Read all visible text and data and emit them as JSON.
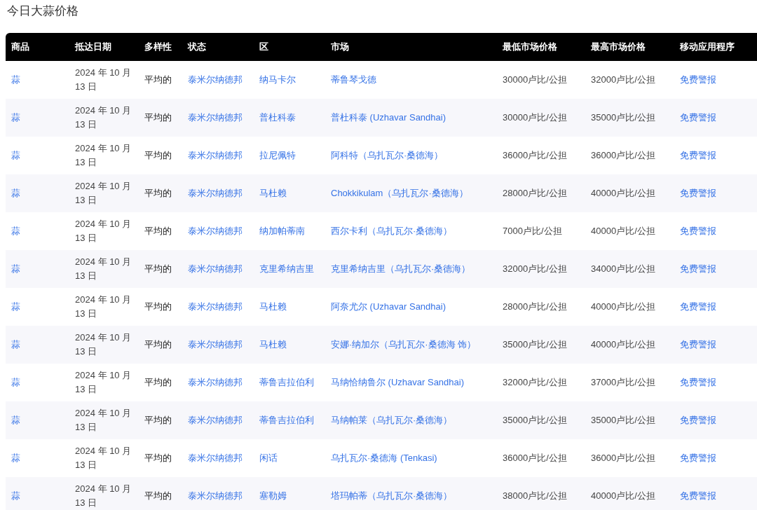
{
  "title": "今日大蒜价格",
  "table": {
    "columns": [
      "商品",
      "抵达日期",
      "多样性",
      "状态",
      "区",
      "市场",
      "最低市场价格",
      "最高市场价格",
      "移动应用程序"
    ],
    "rows": [
      {
        "commodity": "蒜",
        "date": "2024 年 10 月 13 日",
        "variety": "平均的",
        "state": "泰米尔纳德邦",
        "district": "纳马卡尔",
        "market": "蒂鲁琴戈德",
        "min_price": "30000卢比/公担",
        "max_price": "32000卢比/公担",
        "app": "免费警报"
      },
      {
        "commodity": "蒜",
        "date": "2024 年 10 月 13 日",
        "variety": "平均的",
        "state": "泰米尔纳德邦",
        "district": "普杜科泰",
        "market": "普杜科泰 (Uzhavar Sandhai)",
        "min_price": "30000卢比/公担",
        "max_price": "35000卢比/公担",
        "app": "免费警报"
      },
      {
        "commodity": "蒜",
        "date": "2024 年 10 月 13 日",
        "variety": "平均的",
        "state": "泰米尔纳德邦",
        "district": "拉尼佩特",
        "market": "阿科特（乌扎瓦尔·桑德海）",
        "min_price": "36000卢比/公担",
        "max_price": "36000卢比/公担",
        "app": "免费警报"
      },
      {
        "commodity": "蒜",
        "date": "2024 年 10 月 13 日",
        "variety": "平均的",
        "state": "泰米尔纳德邦",
        "district": "马杜赖",
        "market": "Chokkikulam（乌扎瓦尔·桑德海）",
        "min_price": "28000卢比/公担",
        "max_price": "40000卢比/公担",
        "app": "免费警报"
      },
      {
        "commodity": "蒜",
        "date": "2024 年 10 月 13 日",
        "variety": "平均的",
        "state": "泰米尔纳德邦",
        "district": "纳加帕蒂南",
        "market": "西尔卡利（乌扎瓦尔·桑德海）",
        "min_price": "7000卢比/公担",
        "max_price": "40000卢比/公担",
        "app": "免费警报"
      },
      {
        "commodity": "蒜",
        "date": "2024 年 10 月 13 日",
        "variety": "平均的",
        "state": "泰米尔纳德邦",
        "district": "克里希纳吉里",
        "market": "克里希纳吉里（乌扎瓦尔·桑德海）",
        "min_price": "32000卢比/公担",
        "max_price": "34000卢比/公担",
        "app": "免费警报"
      },
      {
        "commodity": "蒜",
        "date": "2024 年 10 月 13 日",
        "variety": "平均的",
        "state": "泰米尔纳德邦",
        "district": "马杜赖",
        "market": "阿奈尤尔 (Uzhavar Sandhai)",
        "min_price": "28000卢比/公担",
        "max_price": "40000卢比/公担",
        "app": "免费警报"
      },
      {
        "commodity": "蒜",
        "date": "2024 年 10 月 13 日",
        "variety": "平均的",
        "state": "泰米尔纳德邦",
        "district": "马杜赖",
        "market": "安娜·纳加尔（乌扎瓦尔·桑德海 饰）",
        "min_price": "35000卢比/公担",
        "max_price": "40000卢比/公担",
        "app": "免费警报"
      },
      {
        "commodity": "蒜",
        "date": "2024 年 10 月 13 日",
        "variety": "平均的",
        "state": "泰米尔纳德邦",
        "district": "蒂鲁吉拉伯利",
        "market": "马纳恰纳鲁尔 (Uzhavar Sandhai)",
        "min_price": "32000卢比/公担",
        "max_price": "37000卢比/公担",
        "app": "免费警报"
      },
      {
        "commodity": "蒜",
        "date": "2024 年 10 月 13 日",
        "variety": "平均的",
        "state": "泰米尔纳德邦",
        "district": "蒂鲁吉拉伯利",
        "market": "马纳帕莱（乌扎瓦尔·桑德海）",
        "min_price": "35000卢比/公担",
        "max_price": "35000卢比/公担",
        "app": "免费警报"
      },
      {
        "commodity": "蒜",
        "date": "2024 年 10 月 13 日",
        "variety": "平均的",
        "state": "泰米尔纳德邦",
        "district": "闲话",
        "market": "乌扎瓦尔·桑德海 (Tenkasi)",
        "min_price": "36000卢比/公担",
        "max_price": "36000卢比/公担",
        "app": "免费警报"
      },
      {
        "commodity": "蒜",
        "date": "2024 年 10 月 13 日",
        "variety": "平均的",
        "state": "泰米尔纳德邦",
        "district": "塞勒姆",
        "market": "塔玛帕蒂（乌扎瓦尔·桑德海）",
        "min_price": "38000卢比/公担",
        "max_price": "40000卢比/公担",
        "app": "免费警报"
      }
    ]
  }
}
